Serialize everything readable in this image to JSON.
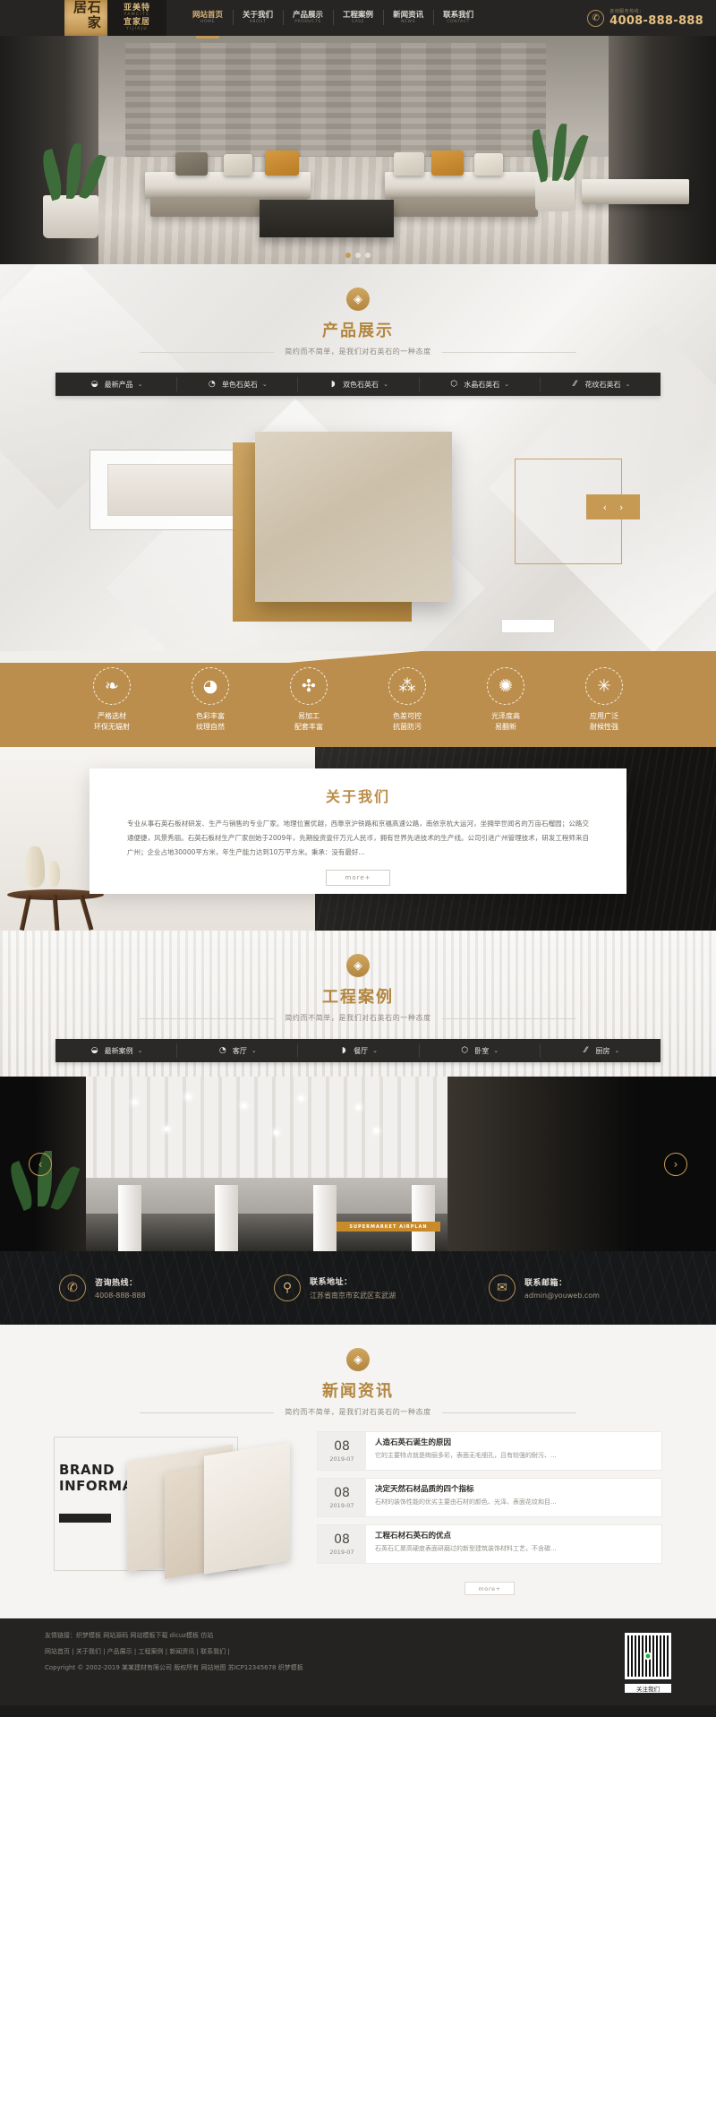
{
  "site": {
    "logo_vertical": "石家居",
    "logo_cn_1": "亚美特",
    "logo_en_1": "YAMEITE",
    "logo_cn_2": "宜家居",
    "logo_en_2": "YIJIAJU"
  },
  "nav": {
    "items": [
      {
        "cn": "网站首页",
        "en": "HOME"
      },
      {
        "cn": "关于我们",
        "en": "ABOUT"
      },
      {
        "cn": "产品展示",
        "en": "PRODUCTS"
      },
      {
        "cn": "工程案例",
        "en": "CASE"
      },
      {
        "cn": "新闻资讯",
        "en": "NEWS"
      },
      {
        "cn": "联系我们",
        "en": "CONTACT"
      }
    ],
    "phone_label": "咨询服务热线：",
    "phone_number": "4008-888-888",
    "phone_icon": "phone-icon"
  },
  "hero": {
    "dots": [
      "1",
      "2",
      "3"
    ]
  },
  "product": {
    "badge_icon": "diamond-icon",
    "title": "产品展示",
    "subtitle": "简约而不简单，是我们对石英石的一种态度",
    "filters": [
      {
        "label": "最新产品",
        "icon": "leaf-badge-icon"
      },
      {
        "label": "单色石英石",
        "icon": "palette-icon"
      },
      {
        "label": "双色石英石",
        "icon": "paint-drop-icon"
      },
      {
        "label": "水晶石英石",
        "icon": "crystal-icon"
      },
      {
        "label": "花纹石英石",
        "icon": "stripes-icon"
      }
    ],
    "caret": "⌄",
    "prev": "‹",
    "next": "›"
  },
  "features": [
    {
      "icon": "leaf-icon",
      "glyph": "❧",
      "line1": "严格选材",
      "line2": "环保无辐射"
    },
    {
      "icon": "palette-icon",
      "glyph": "🎨",
      "line1": "色彩丰富",
      "line2": "纹理自然"
    },
    {
      "icon": "gears-icon",
      "glyph": "✣",
      "line1": "易加工",
      "line2": "配套丰富"
    },
    {
      "icon": "molecule-icon",
      "glyph": "⁂",
      "line1": "色差可控",
      "line2": "抗菌防污"
    },
    {
      "icon": "gear-ring-icon",
      "glyph": "✺",
      "line1": "光泽度高",
      "line2": "易翻新"
    },
    {
      "icon": "snowflake-icon",
      "glyph": "✳",
      "line1": "应用广泛",
      "line2": "耐候性强"
    }
  ],
  "about": {
    "title": "关于我们",
    "text": "专业从事石英石板材研发、生产与销售的专业厂家。地理位置优越，西靠京沪铁路和京福高速公路，南依京杭大运河，坐拥举世闻名的万亩石榴园；公路交通便捷，风景秀丽。石英石板材生产厂家创始于2009年，先期投资壹仟万元人民币，拥有世界先进技术的生产线。公司引进广州管理技术，研发工程师来自广州；企业占地30000平方米，年生产能力达到10万平方米。秉承：没有最好...",
    "more_label": "more+"
  },
  "case": {
    "badge_icon": "diamond-icon",
    "title": "工程案例",
    "subtitle": "简约而不简单，是我们对石英石的一种态度",
    "filters": [
      {
        "label": "最新案例",
        "icon": "leaf-badge-icon"
      },
      {
        "label": "客厅",
        "icon": "palette-icon"
      },
      {
        "label": "餐厅",
        "icon": "paint-drop-icon"
      },
      {
        "label": "卧室",
        "icon": "crystal-icon"
      },
      {
        "label": "厨房",
        "icon": "stripes-icon"
      }
    ],
    "caret": "⌄",
    "prev": "‹",
    "next": "›",
    "sign_text": "SUPERMARKET AIRPLAN"
  },
  "contact": [
    {
      "icon": "phone-icon",
      "glyph": "✆",
      "label": "咨询热线：",
      "value": "4008-888-888"
    },
    {
      "icon": "location-pin-icon",
      "glyph": "⚲",
      "label": "联系地址：",
      "value": "江苏省南京市玄武区玄武湖"
    },
    {
      "icon": "mail-icon",
      "glyph": "✉",
      "label": "联系邮箱：",
      "value": "admin@youweb.com"
    }
  ],
  "news": {
    "badge_icon": "diamond-icon",
    "title": "新闻资讯",
    "subtitle": "简约而不简单，是我们对石英石的一种态度",
    "brand_line1": "BRAND",
    "brand_line2": "INFORMATION",
    "items": [
      {
        "day": "08",
        "ym": "2019-07",
        "title": "人造石英石诞生的原因",
        "desc": "它的主要特点就是绚丽多彩，表面无毛细孔，且有较强的耐污、..."
      },
      {
        "day": "08",
        "ym": "2019-07",
        "title": "决定天然石材品质的四个指标",
        "desc": "石材的装饰性能的优劣主要由石材的颜色、光泽、表面花纹和目..."
      },
      {
        "day": "08",
        "ym": "2019-07",
        "title": "工程石材石英石的优点",
        "desc": "石英石汇聚高硬度表面研磨过的新型建筑装饰材料工艺，不含碳..."
      }
    ],
    "more_label": "more+"
  },
  "footer": {
    "friend_links_label": "友情链接：",
    "friend_links": "织梦模板 网站源码 网站模板下载 dicuz模板 仿站",
    "nav_links": [
      "网站首页",
      "关于我们",
      "产品展示",
      "工程案例",
      "新闻资讯",
      "联系我们"
    ],
    "copyright": "Copyright © 2002-2019 某某建材有限公司 版权所有   网站地图   苏ICP12345678   织梦模板",
    "qr_caption": "关注我们"
  }
}
